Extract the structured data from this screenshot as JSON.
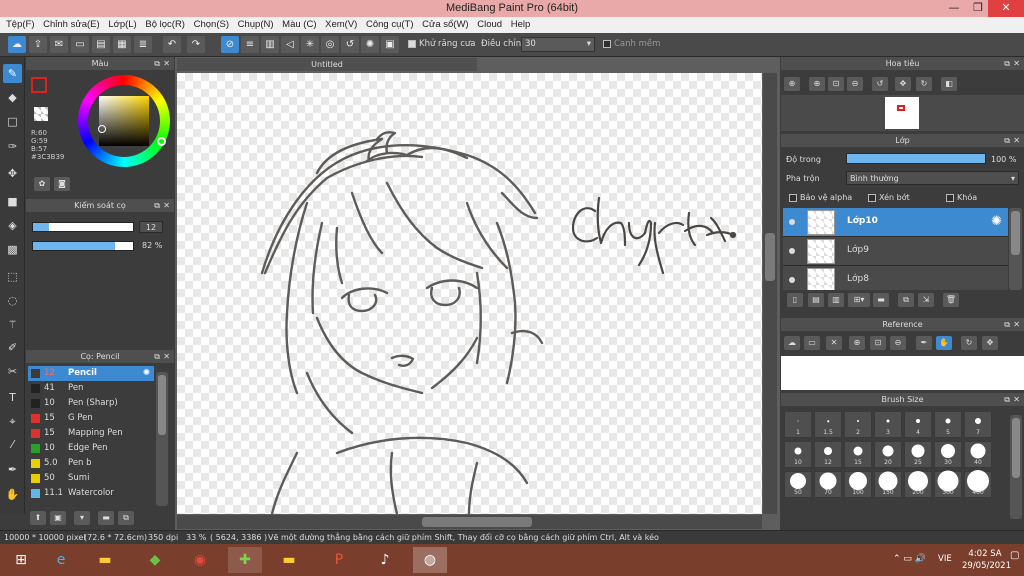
{
  "window": {
    "title": "MediBang Paint Pro (64bit)",
    "min": "—",
    "max": "❐",
    "close": "✕"
  },
  "menu": [
    "Tệp(F)",
    "Chỉnh sửa(E)",
    "Lớp(L)",
    "Bộ lọc(R)",
    "Chọn(S)",
    "Chụp(N)",
    "Màu (C)",
    "Xem(V)",
    "Công cụ(T)",
    "Cửa sổ(W)",
    "Cloud",
    "Help"
  ],
  "toolbar": {
    "antialias_label": "Khử răng cưa",
    "adjust_label": "Điều chỉnh",
    "adjust_value": "30",
    "smooth_label": "Canh mềm"
  },
  "color_panel": {
    "title": "Màu",
    "r": "R:60",
    "g": "G:59",
    "b": "B:57",
    "hex": "#3C3B39",
    "primary": "#3c3b39"
  },
  "brush_control": {
    "title": "Kiểm soát cọ",
    "size": "12",
    "opacity": "82 %",
    "size_fill": 0.16,
    "opacity_fill": 0.82
  },
  "brush_panel": {
    "title": "Cọ: Pencil",
    "items": [
      {
        "size": "12",
        "name": "Pencil",
        "color": "#3c3b39",
        "selected": true
      },
      {
        "size": "41",
        "name": "Pen",
        "color": "#222222"
      },
      {
        "size": "10",
        "name": "Pen (Sharp)",
        "color": "#222222"
      },
      {
        "size": "15",
        "name": "G Pen",
        "color": "#e03030"
      },
      {
        "size": "15",
        "name": "Mapping Pen",
        "color": "#e03030"
      },
      {
        "size": "10",
        "name": "Edge Pen",
        "color": "#2aa02a"
      },
      {
        "size": "5.0",
        "name": "Pen b",
        "color": "#e8d000"
      },
      {
        "size": "50",
        "name": "Sumi",
        "color": "#e8d000"
      },
      {
        "size": "11.1",
        "name": "Watercolor",
        "color": "#5fb9e8"
      }
    ]
  },
  "canvas": {
    "tab": "Untitled",
    "signature": "Chuyệt kt"
  },
  "navigator": {
    "title": "Hoa tiêu"
  },
  "layer_panel": {
    "title": "Lớp",
    "opacity_label": "Độ trong",
    "opacity_value": "100 %",
    "opacity_fill": 1.0,
    "blend_label": "Pha trộn",
    "blend_value": "Bình thường",
    "protect_alpha": "Bảo vệ alpha",
    "clipping": "Xén bớt",
    "lock": "Khóa",
    "layers": [
      {
        "name": "Lớp10",
        "selected": true
      },
      {
        "name": "Lớp9"
      },
      {
        "name": "Lớp8"
      }
    ]
  },
  "reference": {
    "title": "Reference"
  },
  "brush_size": {
    "title": "Brush Size",
    "sizes": [
      "1",
      "1.5",
      "2",
      "3",
      "4",
      "5",
      "7",
      "10",
      "12",
      "15",
      "20",
      "25",
      "30",
      "40",
      "50",
      "70",
      "100",
      "150",
      "200",
      "300",
      "400"
    ]
  },
  "status": {
    "size": "10000 * 10000 pixel",
    "cm": "(72.6 * 72.6cm)",
    "dpi": "350 dpi",
    "zoom": "33 %",
    "coords": "( 5624, 3386 )",
    "hint": "Vẽ một đường thẳng bằng cách giữ phím Shift, Thay đổi cỡ cọ bằng cách giữ phím Ctrl, Alt và kéo"
  },
  "taskbar": {
    "lang": "VIE",
    "time": "4:02 SA",
    "date": "29/05/2021"
  }
}
